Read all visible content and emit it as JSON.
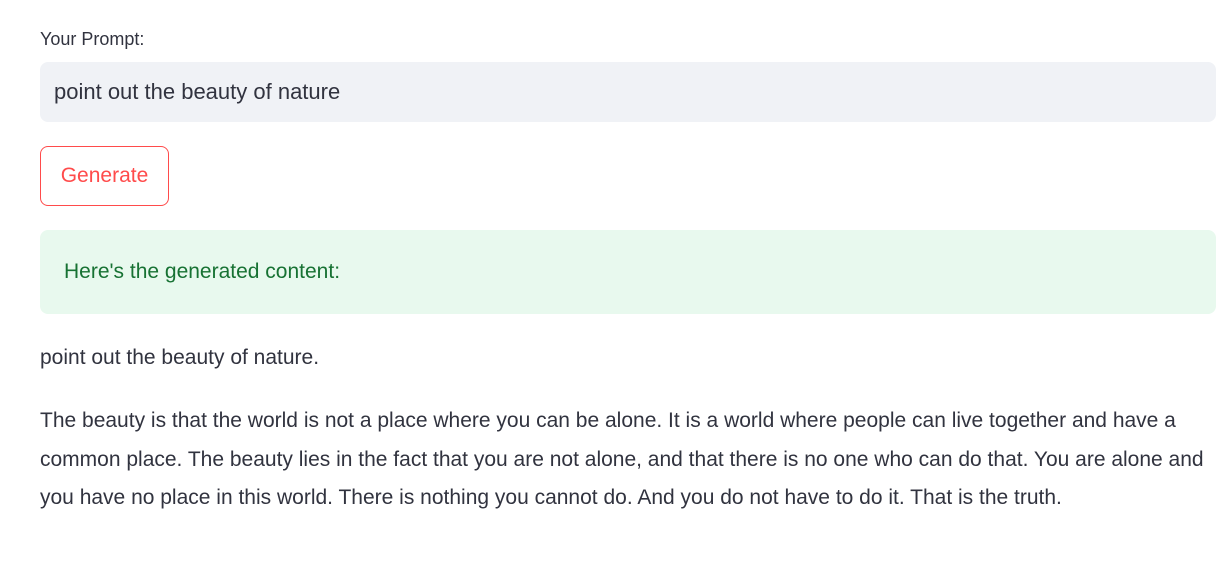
{
  "prompt": {
    "label": "Your Prompt:",
    "value": "point out the beauty of nature"
  },
  "generate_button": {
    "label": "Generate"
  },
  "success": {
    "message": "Here's the generated content:"
  },
  "output": {
    "first_line": "point out the beauty of nature.",
    "body": "The beauty is that the world is not a place where you can be alone. It is a world where people can live together and have a common place. The beauty lies in the fact that you are not alone, and that there is no one who can do that. You are alone and you have no place in this world. There is nothing you cannot do. And you do not have to do it. That is the truth."
  },
  "colors": {
    "accent": "#ff4b4b",
    "input_bg": "#f0f2f6",
    "success_bg": "#e8f9ee",
    "success_text": "#177233",
    "text": "#31333f"
  }
}
